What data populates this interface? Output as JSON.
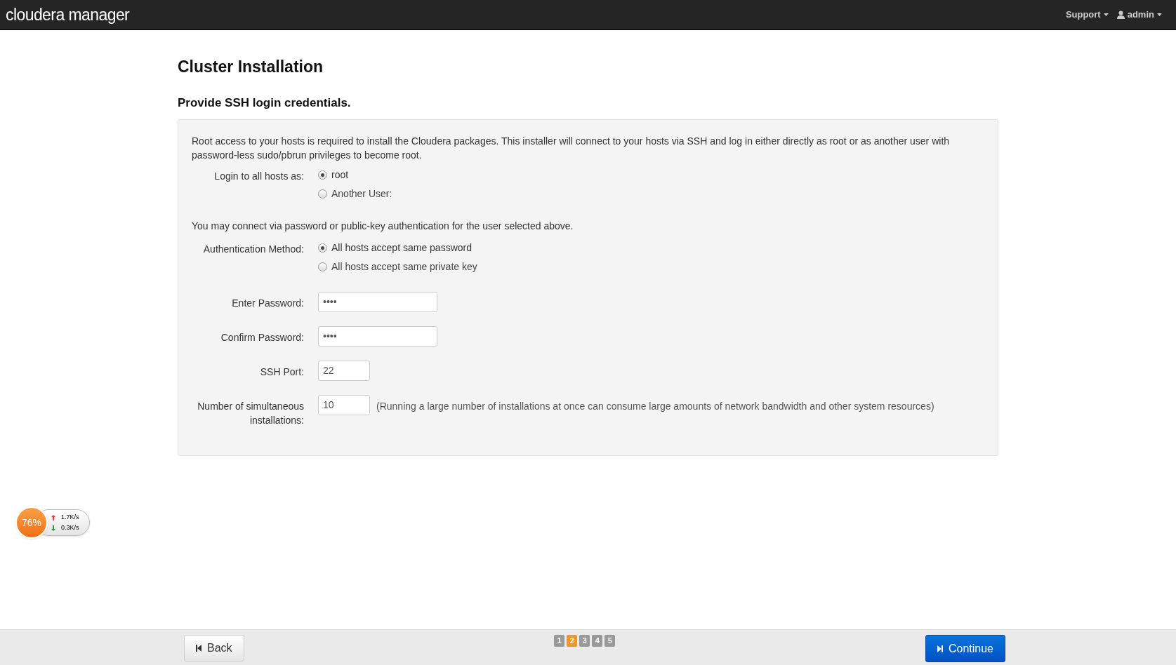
{
  "header": {
    "logo": "cloudera manager",
    "menus": [
      {
        "label": "Support",
        "kind": "plain"
      },
      {
        "label": "admin",
        "kind": "user"
      }
    ]
  },
  "title": "Cluster Installation",
  "subtitle": "Provide SSH login credentials.",
  "intro": "Root access to your hosts is required to install the Cloudera packages. This installer will connect to your hosts via SSH and log in either directly as root or as another user with password-less sudo/pbrun privileges to become root.",
  "login": {
    "label": "Login to all hosts as:",
    "options": [
      {
        "label": "root",
        "selected": true
      },
      {
        "label": "Another User:",
        "selected": false
      }
    ]
  },
  "auth_note": "You may connect via password or public-key authentication for the user selected above.",
  "auth": {
    "label": "Authentication Method:",
    "options": [
      {
        "label": "All hosts accept same password",
        "selected": true
      },
      {
        "label": "All hosts accept same private key",
        "selected": false
      }
    ]
  },
  "fields": [
    {
      "label": "Enter Password:",
      "value": "••••",
      "kind": "password"
    },
    {
      "label": "Confirm Password:",
      "value": "••••",
      "kind": "password"
    },
    {
      "label": "SSH Port:",
      "value": "22",
      "kind": "number"
    },
    {
      "label": "Number of simultaneous installations:",
      "value": "10",
      "kind": "number",
      "note": "(Running a large number of installations at once can consume large amounts of network bandwidth and other system resources)"
    }
  ],
  "widget": {
    "percent": "76%",
    "up": "1.7K/s",
    "down": "0.3K/s"
  },
  "footer": {
    "back": "Back",
    "continue": "Continue",
    "steps": [
      {
        "label": "1",
        "selected": false
      },
      {
        "label": "2",
        "selected": true
      },
      {
        "label": "3",
        "selected": false
      },
      {
        "label": "4",
        "selected": false
      },
      {
        "label": "5",
        "selected": false
      }
    ]
  }
}
